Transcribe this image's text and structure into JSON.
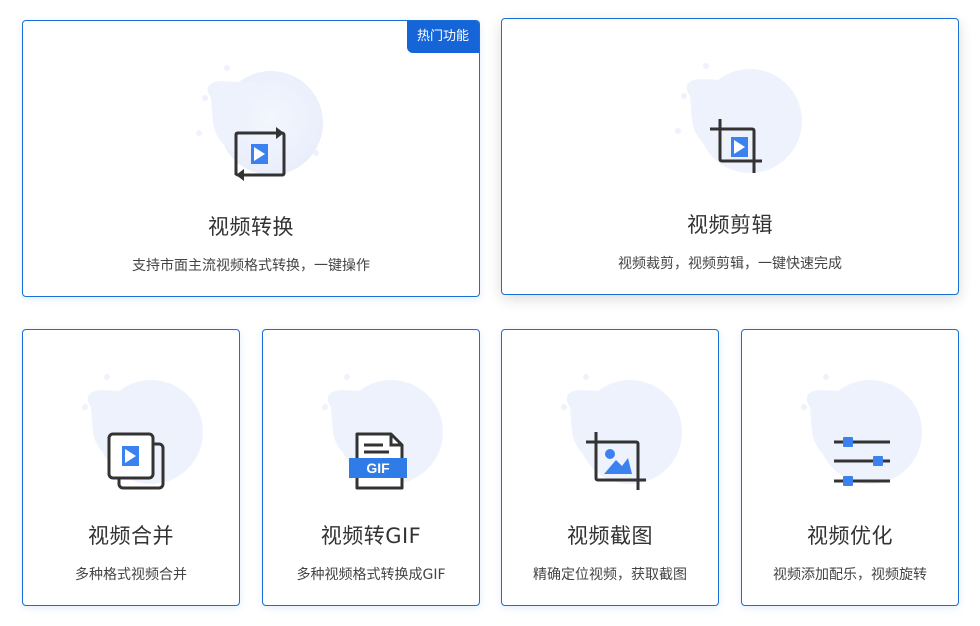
{
  "colors": {
    "accent": "#1a6fd6",
    "icon_blue": "#3b82f0",
    "icon_dark": "#333333",
    "blob": "#eef2fc"
  },
  "cards": [
    {
      "title": "视频转换",
      "desc": "支持市面主流视频格式转换，一键操作",
      "badge": "热门功能",
      "icon": "video-convert-icon"
    },
    {
      "title": "视频剪辑",
      "desc": "视频裁剪，视频剪辑，一键快速完成",
      "icon": "video-crop-icon"
    },
    {
      "title": "视频合并",
      "desc": "多种格式视频合并",
      "icon": "video-merge-icon"
    },
    {
      "title": "视频转GIF",
      "desc": "多种视频格式转换成GIF",
      "icon": "gif-file-icon",
      "icon_label": "GIF"
    },
    {
      "title": "视频截图",
      "desc": "精确定位视频，获取截图",
      "icon": "screenshot-crop-icon"
    },
    {
      "title": "视频优化",
      "desc": "视频添加配乐，视频旋转",
      "icon": "sliders-icon"
    }
  ]
}
